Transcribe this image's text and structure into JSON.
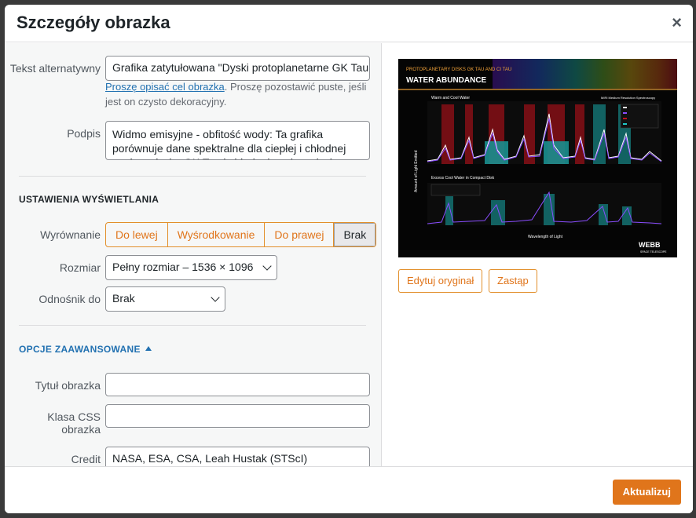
{
  "modal": {
    "title": "Szczegóły obrazka",
    "close_icon": "×"
  },
  "alt": {
    "label": "Tekst alternatywny",
    "value": "Grafika zatytułowana \"Dyski protoplanetarne GK Tau",
    "help_link": "Proszę opisać cel obrazka",
    "help_text": ". Proszę pozostawić puste, jeśli jest on czysto dekoracyjny."
  },
  "caption": {
    "label": "Podpis",
    "value": "Widmo emisyjne - obfitość wody: Ta grafika porównuje dane spektralne dla ciepłej i chłodnej wody w dysku GK Tau i chłodnej wody w dysku"
  },
  "display": {
    "heading": "Ustawienia wyświetlania",
    "align_label": "Wyrównanie",
    "align_options": [
      "Do lewej",
      "Wyśrodkowanie",
      "Do prawej",
      "Brak"
    ],
    "align_selected": "Brak",
    "size_label": "Rozmiar",
    "size_value": "Pełny rozmiar – 1536 × 1096",
    "link_label": "Odnośnik do",
    "link_value": "Brak"
  },
  "advanced": {
    "heading": "OPCJE ZAAWANSOWANE",
    "title_label": "Tytuł obrazka",
    "title_value": "",
    "css_label": "Klasa CSS obrazka",
    "css_value": "",
    "credit_label": "Credit",
    "credit_value": "NASA, ESA, CSA, Leah Hustak (STScI)"
  },
  "preview": {
    "kicker": "PROTOPLANETARY DISKS GK TAU AND CI TAU",
    "title": "WATER ABUNDANCE",
    "panel1_title": "Warm and Cool Water",
    "panel1_instrument": "MIRI Medium Resolution Spectroscopy",
    "panel2_title": "Excess Cool Water in Compact Disk",
    "ylabel": "Amount of Light Emitted",
    "xlabel": "Wavelength of Light",
    "logo": "WEBB",
    "logo_sub": "SPACE TELESCOPE",
    "edit_button": "Edytuj oryginał",
    "replace_button": "Zastąp"
  },
  "footer": {
    "update_button": "Aktualizuj"
  },
  "colors": {
    "accent": "#e0751b",
    "link": "#2271b1",
    "spectrum_purple": "#8a4dff",
    "cool_water": "#1fc7c7",
    "warm_water": "#c0121a"
  }
}
